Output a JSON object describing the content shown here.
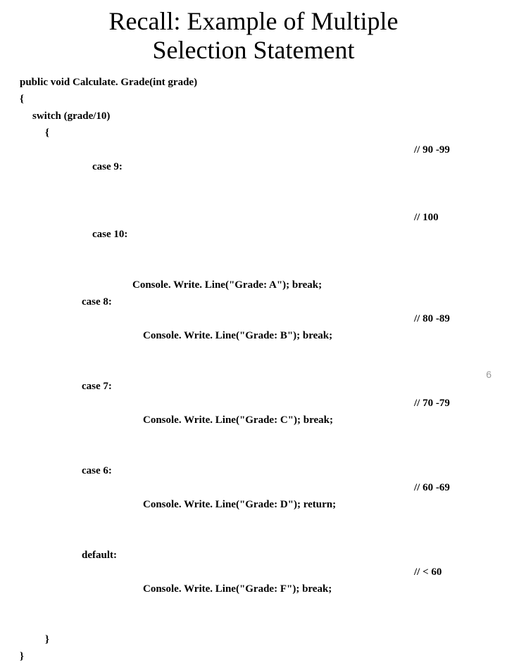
{
  "title_line1": "Recall: Example of Multiple",
  "title_line2": "Selection Statement",
  "code": {
    "sig": "public void Calculate. Grade(int grade)",
    "open_brace": "{",
    "switch_line": "switch (grade/10)",
    "open_brace2": "{",
    "case9": "case 9:",
    "cmt9": "// 90 -99",
    "case10": "case 10:",
    "cmt10": "// 100",
    "writeA": "Console. Write. Line(\"Grade: A\"); break;",
    "case8": "case 8:",
    "writeB": "Console. Write. Line(\"Grade: B\"); break;",
    "cmt8": "// 80 -89",
    "case7": "case 7:",
    "writeC": "Console. Write. Line(\"Grade: C\"); break;",
    "cmt7": "// 70 -79",
    "case6": "case 6:",
    "writeD": "Console. Write. Line(\"Grade: D\"); return;",
    "cmt6": "// 60 -69",
    "default": "default:",
    "writeF": "Console. Write. Line(\"Grade: F\"); break;",
    "cmtF": "// < 60",
    "close_brace2": "}",
    "close_brace": "}"
  },
  "page_number": "6"
}
